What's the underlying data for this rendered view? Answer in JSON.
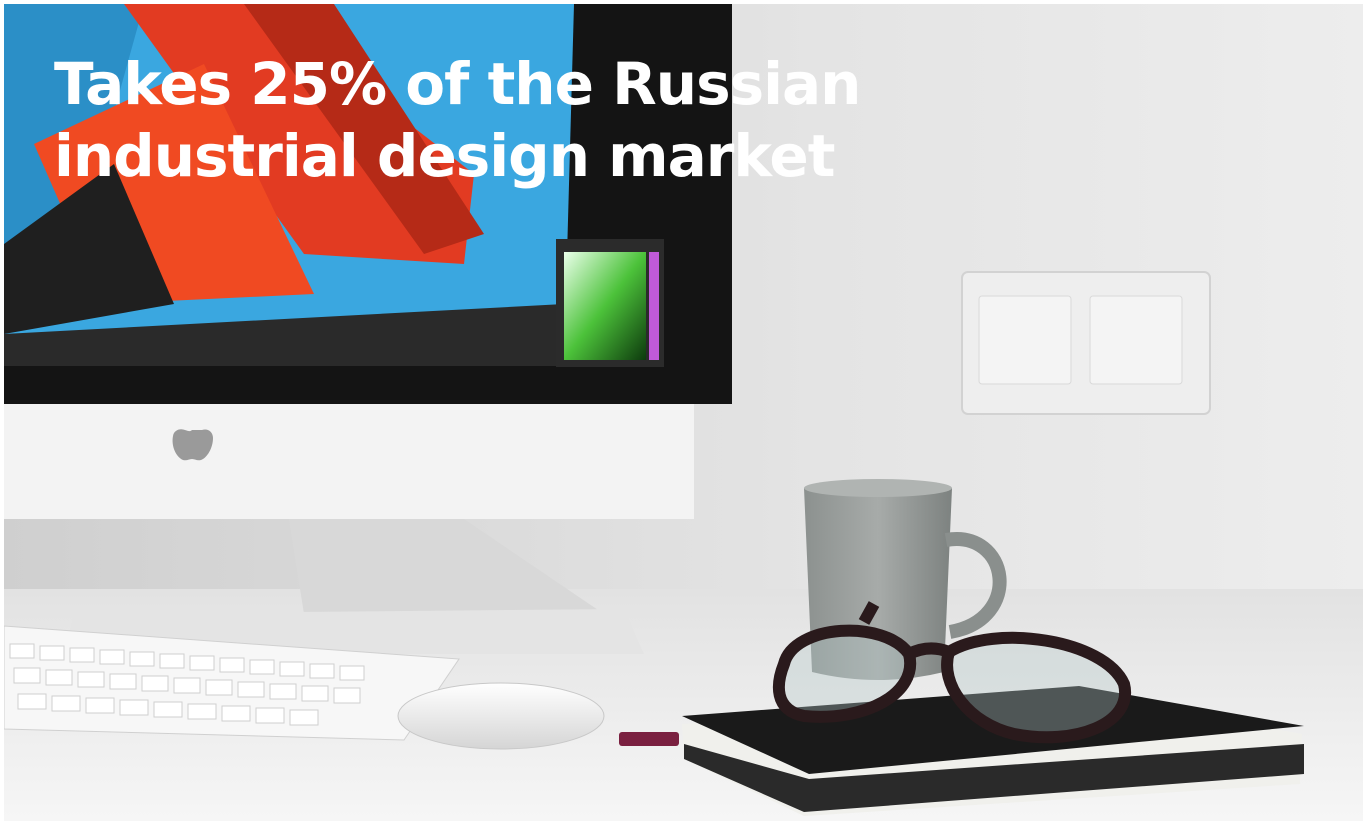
{
  "headline": {
    "line1": "Takes 25% of the Russian",
    "line2": "industrial design market"
  },
  "colors": {
    "headline_text": "#ffffff",
    "wall": "#e6e6e6",
    "desk": "#f2f2f2"
  }
}
